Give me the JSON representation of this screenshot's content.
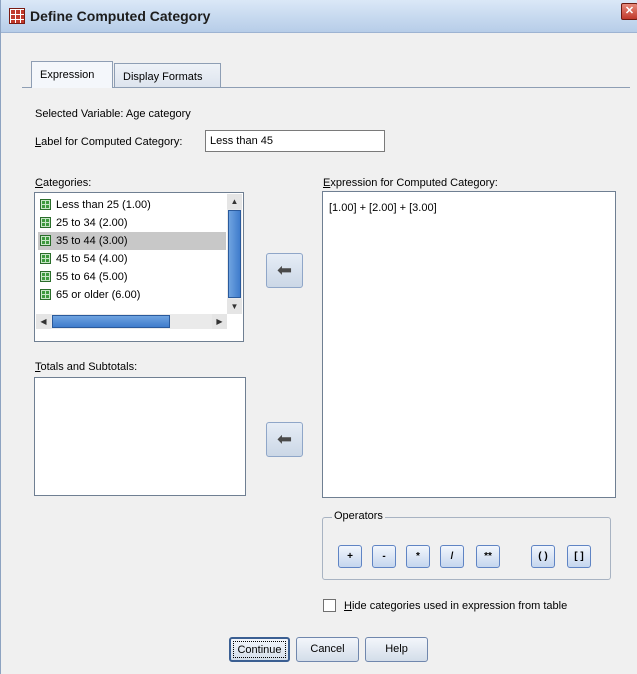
{
  "window": {
    "title": "Define Computed Category",
    "close_glyph": "✕"
  },
  "tabs": [
    {
      "label": "Expression",
      "active": true
    },
    {
      "label": "Display Formats",
      "active": false
    }
  ],
  "selected_variable": "Selected Variable: Age category",
  "label_field": {
    "label_prefix": "L",
    "label_rest": "abel for Computed Category:",
    "value": "Less than 45"
  },
  "categories": {
    "header_prefix": "C",
    "header_rest": "ategories:",
    "items": [
      {
        "label": "Less than 25 (1.00)"
      },
      {
        "label": "25 to 34 (2.00)"
      },
      {
        "label": "35 to 44 (3.00)",
        "selected": true
      },
      {
        "label": "45 to 54 (4.00)"
      },
      {
        "label": "55 to 64 (5.00)"
      },
      {
        "label": "65 or older (6.00)"
      }
    ]
  },
  "totals": {
    "header_prefix": "T",
    "header_rest": "otals and Subtotals:"
  },
  "expression": {
    "header_prefix": "E",
    "header_rest": "xpression for Computed Category:",
    "value": "[1.00] + [2.00] + [3.00]"
  },
  "move_glyph": "⬅",
  "operators": {
    "legend": "Operators",
    "buttons": [
      "+",
      "-",
      "*",
      "/",
      "**",
      "( )",
      "[ ]"
    ]
  },
  "hide_checkbox": {
    "label_prefix": "H",
    "label_rest": "ide categories used in expression from table",
    "checked": false
  },
  "buttons": {
    "continue": "Continue",
    "cancel": "Cancel",
    "help": "Help"
  },
  "colors": {
    "accent": "#3f7ccc",
    "category_icon": "#3e9a3e",
    "title_bg": "#c6d9ef"
  }
}
